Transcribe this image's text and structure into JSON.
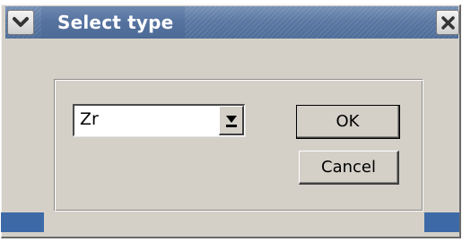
{
  "window": {
    "title": "Select type",
    "colors": {
      "titlebar": "#5a78a3",
      "face": "#d4d0c8",
      "text": "#ffffff"
    },
    "icons": {
      "menu": "chevron-down-icon",
      "close": "close-icon"
    }
  },
  "type_select": {
    "value": "Zr",
    "icon": "dropdown-arrow-icon"
  },
  "buttons": {
    "ok_label": "OK",
    "cancel_label": "Cancel"
  }
}
